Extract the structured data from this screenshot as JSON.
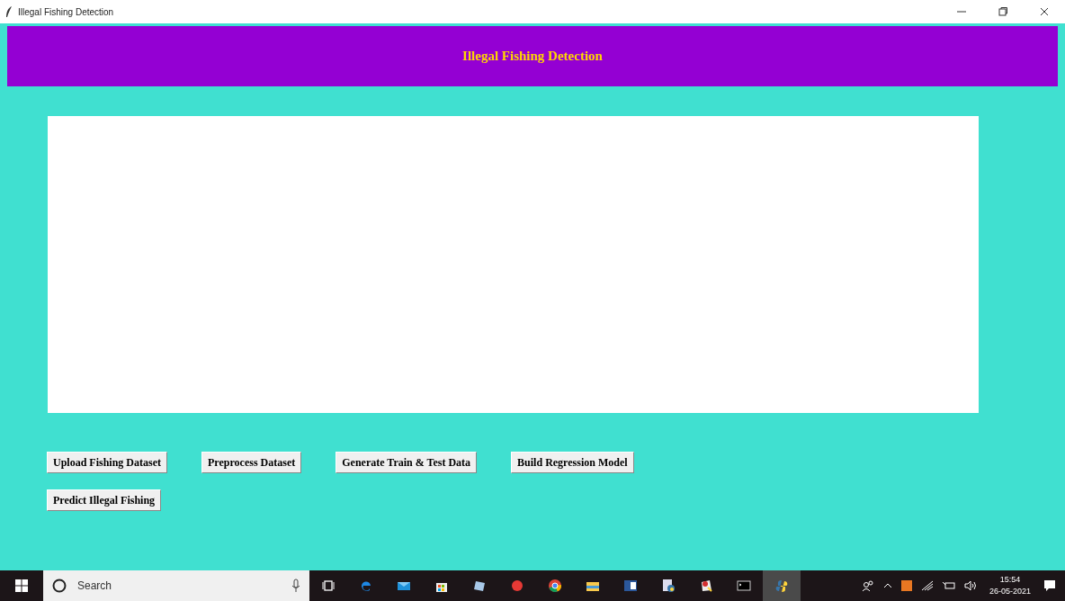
{
  "window": {
    "title": "Illegal Fishing Detection"
  },
  "header": {
    "title": "Illegal Fishing Detection"
  },
  "buttons": [
    {
      "label": "Upload Fishing Dataset"
    },
    {
      "label": "Preprocess Dataset"
    },
    {
      "label": "Generate Train & Test Data"
    },
    {
      "label": "Build Regression Model"
    },
    {
      "label": "Predict Illegal Fishing"
    }
  ],
  "taskbar": {
    "search": {
      "placeholder": "Search"
    },
    "time": "15:54",
    "date": "26-05-2021"
  }
}
